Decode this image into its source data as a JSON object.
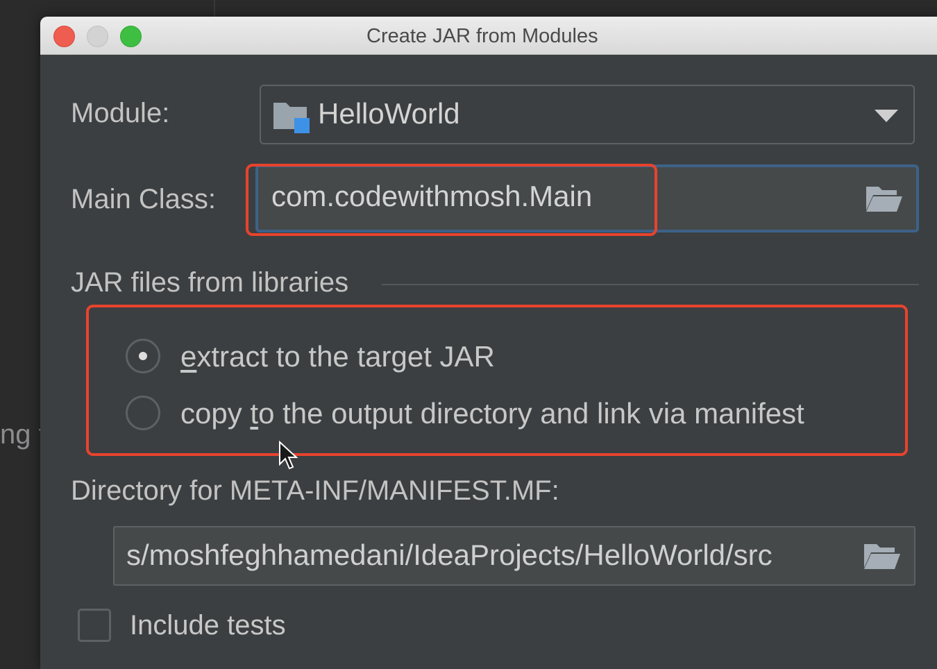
{
  "backdrop": {
    "partial_text": "ng t"
  },
  "window": {
    "title": "Create JAR from Modules"
  },
  "module": {
    "label": "Module:",
    "value": "HelloWorld"
  },
  "main_class": {
    "label": "Main Class:",
    "value": "com.codewithmosh.Main"
  },
  "jar_section": {
    "title": "JAR files from libraries",
    "options": [
      {
        "pre": "",
        "mnemonic": "e",
        "post": "xtract to the target JAR",
        "selected": true
      },
      {
        "pre": "copy ",
        "mnemonic": "t",
        "post": "o the output directory and link via manifest",
        "selected": false
      }
    ]
  },
  "manifest": {
    "label": "Directory for META-INF/MANIFEST.MF:",
    "value": "s/moshfeghhamedani/IdeaProjects/HelloWorld/src"
  },
  "include_tests": {
    "label": "Include tests",
    "checked": false
  },
  "colors": {
    "highlight": "#e8432d",
    "focus": "#3d6289",
    "background": "#3c3f41"
  }
}
